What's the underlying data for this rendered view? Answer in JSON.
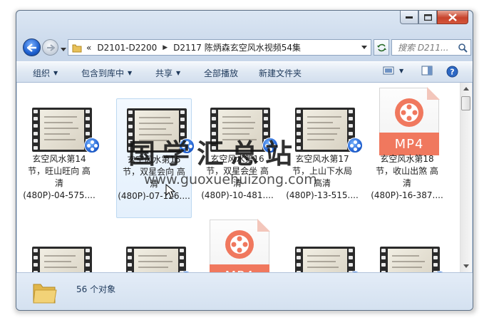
{
  "address": {
    "overflow": "«",
    "crumbs": [
      "D2101-D2200",
      "D2117 陈炳森玄空风水视频54集"
    ]
  },
  "search": {
    "placeholder": "搜索 D211..."
  },
  "toolbar": {
    "organize": "组织",
    "include_in_library": "包含到库中",
    "share": "共享",
    "play_all": "全部播放",
    "new_folder": "新建文件夹"
  },
  "items": [
    {
      "type": "video",
      "lines": [
        "玄空风水第14",
        "节，旺山旺向 高",
        "清",
        "(480P)-04-575...."
      ]
    },
    {
      "type": "video",
      "selected": true,
      "lines": [
        "玄空风水第15",
        "节，双星会向 高",
        "清",
        "(480P)-07-126...."
      ]
    },
    {
      "type": "video",
      "lines": [
        "玄空风水第16",
        "节，双星会坐 高",
        "清",
        "(480P)-10-481...."
      ]
    },
    {
      "type": "video",
      "lines": [
        "玄空风水第17",
        "节，上山下水局",
        "高清",
        "(480P)-13-515...."
      ]
    },
    {
      "type": "mp4",
      "band": "MP4",
      "lines": [
        "玄空风水第18",
        "节，收山出煞 高",
        "清",
        "(480P)-16-387...."
      ]
    }
  ],
  "row2": [
    {
      "type": "video"
    },
    {
      "type": "video"
    },
    {
      "type": "mp4",
      "band": "MP4"
    },
    {
      "type": "video"
    },
    {
      "type": "video"
    }
  ],
  "status": {
    "count": "56 个对象"
  },
  "watermark": {
    "text": "国学汇总站",
    "url": "www.guoxuehuizong.com"
  },
  "colors": {
    "accent": "#1f5fd0",
    "mp4": "#f0785e",
    "selection": "#e4f0fc"
  }
}
